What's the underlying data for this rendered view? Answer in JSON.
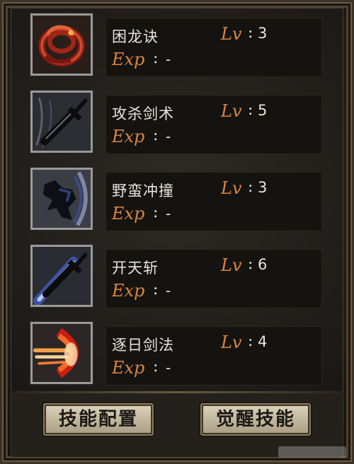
{
  "skills": [
    {
      "name": "困龙诀",
      "lv_label": "Lv",
      "lv_colon": ":",
      "level": "3",
      "exp_label": "Exp",
      "exp_colon": ":",
      "exp_value": "-",
      "icon": "coiled-dragon-icon"
    },
    {
      "name": "攻杀剑术",
      "lv_label": "Lv",
      "lv_colon": ":",
      "level": "5",
      "exp_label": "Exp",
      "exp_colon": ":",
      "exp_value": "-",
      "icon": "sword-slash-icon"
    },
    {
      "name": "野蛮冲撞",
      "lv_label": "Lv",
      "lv_colon": ":",
      "level": "3",
      "exp_label": "Exp",
      "exp_colon": ":",
      "exp_value": "-",
      "icon": "charging-warrior-icon"
    },
    {
      "name": "开天斩",
      "lv_label": "Lv",
      "lv_colon": ":",
      "level": "6",
      "exp_label": "Exp",
      "exp_colon": ":",
      "exp_value": "-",
      "icon": "glowing-sword-icon"
    },
    {
      "name": "逐日剑法",
      "lv_label": "Lv",
      "lv_colon": ":",
      "level": "4",
      "exp_label": "Exp",
      "exp_colon": ":",
      "exp_value": "-",
      "icon": "fire-wave-icon"
    }
  ],
  "buttons": {
    "config_label": "技能配置",
    "awaken_label": "觉醒技能"
  },
  "colors": {
    "label_orange": "#d8853e",
    "text_light": "#e9e4da",
    "button_face": "#cfc5ab"
  }
}
